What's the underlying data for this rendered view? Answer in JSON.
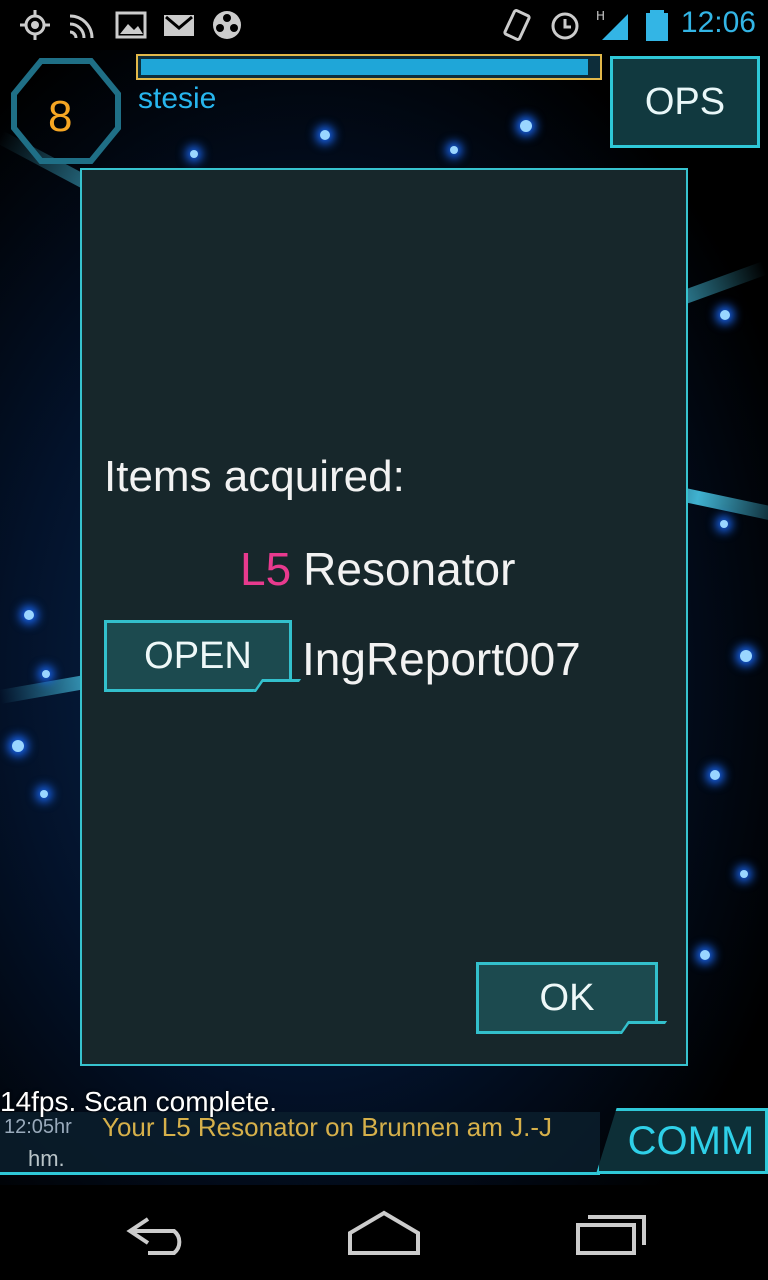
{
  "status_bar": {
    "time": "12:06",
    "icons": [
      "gps-icon",
      "wireless-icon",
      "gallery-icon",
      "gmail-icon",
      "media-icon",
      "vibrate-icon",
      "alarm-icon",
      "signal-hspa-icon",
      "battery-icon"
    ]
  },
  "hud": {
    "level": "8",
    "agent_name": "stesie",
    "xp_fraction": 0.99,
    "ops_label": "OPS"
  },
  "dialog": {
    "title": "Items acquired:",
    "item_level": "L5",
    "item_name": "Resonator",
    "open_label": "OPEN",
    "report_name": "IngReport007",
    "ok_label": "OK"
  },
  "comm": {
    "scan_status": "14fps. Scan complete.",
    "time": "12:05hr",
    "message": "Your L5 Resonator on Brunnen am J.-J",
    "message_cont": "hm.",
    "button_label": "COMM"
  },
  "nav": [
    "back-icon",
    "home-icon",
    "recents-icon"
  ],
  "colors": {
    "accent": "#2fc8d8",
    "level": "#f6a623",
    "item_level": "#e83a8e",
    "status_time": "#33b5e5"
  }
}
